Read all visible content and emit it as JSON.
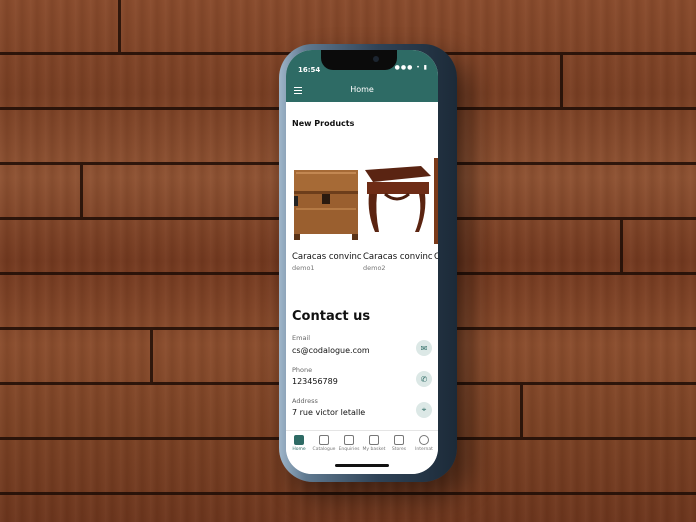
{
  "status_bar": {
    "time": "16:54",
    "icons": "●●● • ▮"
  },
  "header": {
    "title": "Home",
    "menu_icon": "hamburger-menu-icon"
  },
  "new_products": {
    "title": "New Products",
    "items": [
      {
        "name": "Caracas convinc...",
        "sub": "demo1"
      },
      {
        "name": "Caracas convinc...",
        "sub": "demo2"
      },
      {
        "name": "C",
        "sub": ""
      }
    ]
  },
  "contact": {
    "title": "Contact us",
    "email_label": "Email",
    "email_value": "cs@codalogue.com",
    "phone_label": "Phone",
    "phone_value": "123456789",
    "address_label": "Address",
    "address_value": "7 rue victor letalle"
  },
  "tabs": [
    {
      "label": "Home",
      "icon": "home-shield-icon",
      "active": true
    },
    {
      "label": "Catalogue",
      "icon": "catalogue-icon",
      "active": false
    },
    {
      "label": "Enquiries",
      "icon": "enquiries-icon",
      "active": false
    },
    {
      "label": "My basket",
      "icon": "basket-icon",
      "active": false
    },
    {
      "label": "Stores",
      "icon": "stores-icon",
      "active": false
    },
    {
      "label": "Internat",
      "icon": "globe-icon",
      "active": false
    }
  ],
  "colors": {
    "brand": "#2e6b65",
    "icon_bg": "#dce8e6"
  }
}
